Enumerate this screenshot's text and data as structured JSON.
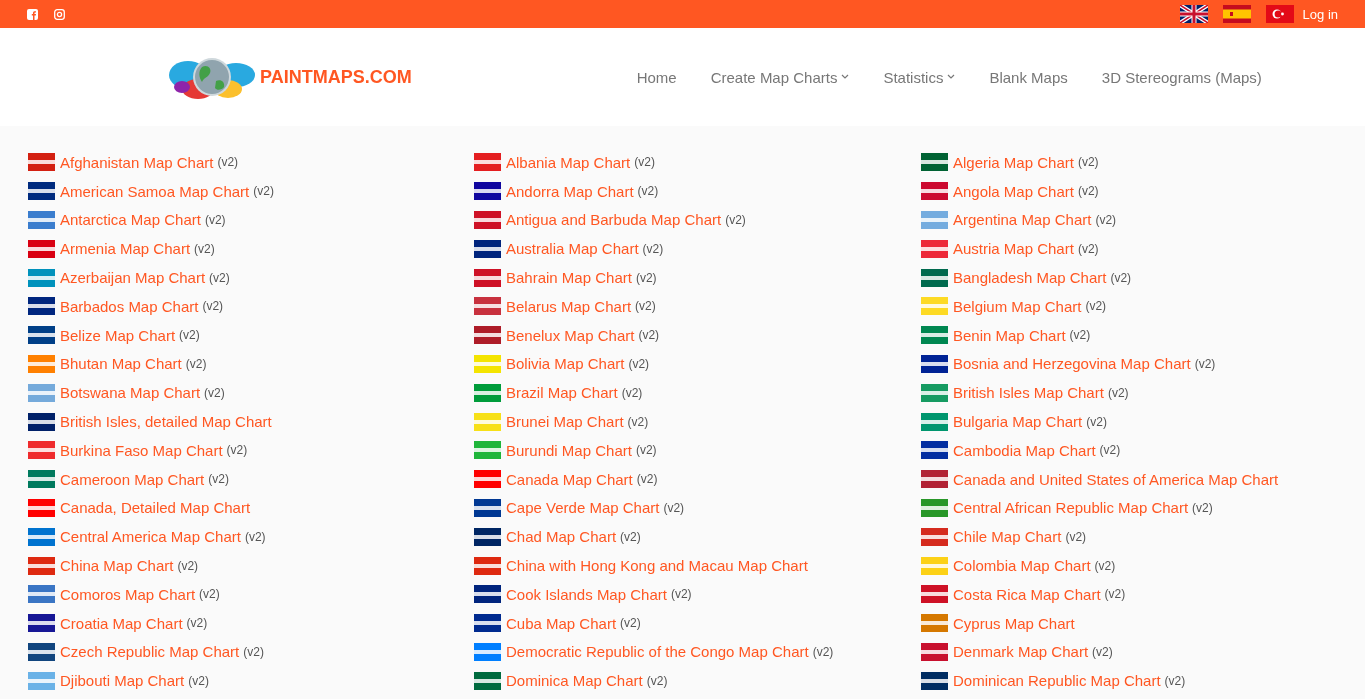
{
  "top_bar": {
    "login": "Log in"
  },
  "logo": {
    "text": "PAINTMAPS.COM"
  },
  "nav": [
    {
      "label": "Home",
      "dropdown": false
    },
    {
      "label": "Create Map Charts",
      "dropdown": true
    },
    {
      "label": "Statistics",
      "dropdown": true
    },
    {
      "label": "Blank Maps",
      "dropdown": false
    },
    {
      "label": "3D Stereograms (Maps)",
      "dropdown": false
    }
  ],
  "countries": [
    {
      "name": "Afghanistan Map Chart",
      "suffix": "(v2)",
      "color": "#d32011"
    },
    {
      "name": "Albania Map Chart",
      "suffix": "(v2)",
      "color": "#e41e20"
    },
    {
      "name": "Algeria Map Chart",
      "suffix": "(v2)",
      "color": "#006233"
    },
    {
      "name": "American Samoa Map Chart",
      "suffix": "(v2)",
      "color": "#002b7f"
    },
    {
      "name": "Andorra Map Chart",
      "suffix": "(v2)",
      "color": "#10069f"
    },
    {
      "name": "Angola Map Chart",
      "suffix": "(v2)",
      "color": "#cc092f"
    },
    {
      "name": "Antarctica Map Chart",
      "suffix": "(v2)",
      "color": "#3a7dce"
    },
    {
      "name": "Antigua and Barbuda Map Chart",
      "suffix": "(v2)",
      "color": "#ce1126"
    },
    {
      "name": "Argentina Map Chart",
      "suffix": "(v2)",
      "color": "#74acdf"
    },
    {
      "name": "Armenia Map Chart",
      "suffix": "(v2)",
      "color": "#d90012"
    },
    {
      "name": "Australia Map Chart",
      "suffix": "(v2)",
      "color": "#00247d"
    },
    {
      "name": "Austria Map Chart",
      "suffix": "(v2)",
      "color": "#ed2939"
    },
    {
      "name": "Azerbaijan Map Chart",
      "suffix": "(v2)",
      "color": "#0092bc"
    },
    {
      "name": "Bahrain Map Chart",
      "suffix": "(v2)",
      "color": "#ce1126"
    },
    {
      "name": "Bangladesh Map Chart",
      "suffix": "(v2)",
      "color": "#006a4e"
    },
    {
      "name": "Barbados Map Chart",
      "suffix": "(v2)",
      "color": "#00267f"
    },
    {
      "name": "Belarus Map Chart",
      "suffix": "(v2)",
      "color": "#c8313e"
    },
    {
      "name": "Belgium Map Chart",
      "suffix": "(v2)",
      "color": "#fdda24"
    },
    {
      "name": "Belize Map Chart",
      "suffix": "(v2)",
      "color": "#003f87"
    },
    {
      "name": "Benelux Map Chart",
      "suffix": "(v2)",
      "color": "#ae1c28"
    },
    {
      "name": "Benin Map Chart",
      "suffix": "(v2)",
      "color": "#008751"
    },
    {
      "name": "Bhutan Map Chart",
      "suffix": "(v2)",
      "color": "#ff8000"
    },
    {
      "name": "Bolivia Map Chart",
      "suffix": "(v2)",
      "color": "#f4e400"
    },
    {
      "name": "Bosnia and Herzegovina Map Chart",
      "suffix": "(v2)",
      "color": "#002395"
    },
    {
      "name": "Botswana Map Chart",
      "suffix": "(v2)",
      "color": "#75aadb"
    },
    {
      "name": "Brazil Map Chart",
      "suffix": "(v2)",
      "color": "#009c3b"
    },
    {
      "name": "British Isles Map Chart",
      "suffix": "(v2)",
      "color": "#169b62"
    },
    {
      "name": "British Isles, detailed Map Chart",
      "color": "#012169"
    },
    {
      "name": "Brunei Map Chart",
      "suffix": "(v2)",
      "color": "#f7e017"
    },
    {
      "name": "Bulgaria Map Chart",
      "suffix": "(v2)",
      "color": "#00966e"
    },
    {
      "name": "Burkina Faso Map Chart",
      "suffix": "(v2)",
      "color": "#ef2b2d"
    },
    {
      "name": "Burundi Map Chart",
      "suffix": "(v2)",
      "color": "#1eb53a"
    },
    {
      "name": "Cambodia Map Chart",
      "suffix": "(v2)",
      "color": "#032ea1"
    },
    {
      "name": "Cameroon Map Chart",
      "suffix": "(v2)",
      "color": "#007a5e"
    },
    {
      "name": "Canada Map Chart",
      "suffix": "(v2)",
      "color": "#ff0000"
    },
    {
      "name": "Canada and United States of America Map Chart",
      "color": "#b22234"
    },
    {
      "name": "Canada, Detailed Map Chart",
      "color": "#ff0000"
    },
    {
      "name": "Cape Verde Map Chart",
      "suffix": "(v2)",
      "color": "#003893"
    },
    {
      "name": "Central African Republic Map Chart",
      "suffix": "(v2)",
      "color": "#289728"
    },
    {
      "name": "Central America Map Chart",
      "suffix": "(v2)",
      "color": "#0073cf"
    },
    {
      "name": "Chad Map Chart",
      "suffix": "(v2)",
      "color": "#002664"
    },
    {
      "name": "Chile Map Chart",
      "suffix": "(v2)",
      "color": "#d52b1e"
    },
    {
      "name": "China Map Chart",
      "suffix": "(v2)",
      "color": "#de2910"
    },
    {
      "name": "China with Hong Kong and Macau Map Chart",
      "color": "#de2910"
    },
    {
      "name": "Colombia Map Chart",
      "suffix": "(v2)",
      "color": "#fcd116"
    },
    {
      "name": "Comoros Map Chart",
      "suffix": "(v2)",
      "color": "#3a75c4"
    },
    {
      "name": "Cook Islands Map Chart",
      "suffix": "(v2)",
      "color": "#00247d"
    },
    {
      "name": "Costa Rica Map Chart",
      "suffix": "(v2)",
      "color": "#ce1126"
    },
    {
      "name": "Croatia Map Chart",
      "suffix": "(v2)",
      "color": "#171796"
    },
    {
      "name": "Cuba Map Chart",
      "suffix": "(v2)",
      "color": "#002a8f"
    },
    {
      "name": "Cyprus Map Chart",
      "color": "#d57800"
    },
    {
      "name": "Czech Republic Map Chart",
      "suffix": "(v2)",
      "color": "#11457e"
    },
    {
      "name": "Democratic Republic of the Congo Map Chart",
      "suffix": "(v2)",
      "color": "#007fff"
    },
    {
      "name": "Denmark Map Chart",
      "suffix": "(v2)",
      "color": "#c8102e"
    },
    {
      "name": "Djibouti Map Chart",
      "suffix": "(v2)",
      "color": "#6ab2e7"
    },
    {
      "name": "Dominica Map Chart",
      "suffix": "(v2)",
      "color": "#006b3f"
    },
    {
      "name": "Dominican Republic Map Chart",
      "suffix": "(v2)",
      "color": "#002d62"
    }
  ]
}
